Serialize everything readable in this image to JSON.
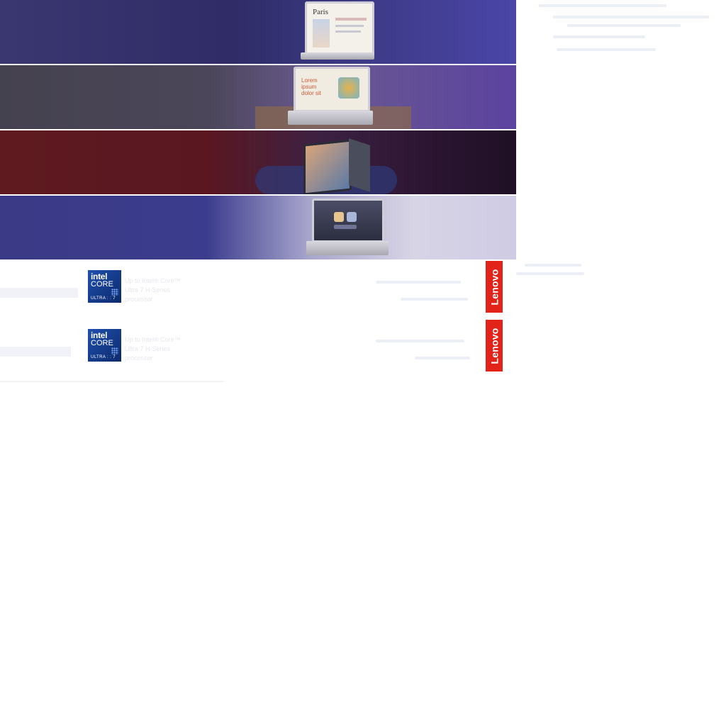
{
  "banners": [
    {
      "scene": "laptop-open-paris-page",
      "screen_text": "Paris"
    },
    {
      "scene": "laptop-open-illustration-page",
      "screen_text": "Lorem ipsum dolor sit"
    },
    {
      "scene": "convertible-tent-mode-photo"
    },
    {
      "scene": "laptop-open-app-launcher"
    }
  ],
  "footer_banners": [
    {
      "intel_word": "intel",
      "core_word": "CORE",
      "ultra_word": "ULTRA",
      "ultra_number": "7",
      "processor_line1": "Up to Intel® Core™",
      "processor_line2": "Ultra 7 H-Series",
      "processor_line3": "processor",
      "brand": "Lenovo"
    },
    {
      "intel_word": "intel",
      "core_word": "CORE",
      "ultra_word": "ULTRA",
      "ultra_number": "7",
      "processor_line1": "Up to Intel® Core™",
      "processor_line2": "Ultra 7 H-Series",
      "processor_line3": "processor",
      "brand": "Lenovo"
    }
  ],
  "colors": {
    "lenovo_red": "#e2231a",
    "intel_blue": "#1f4fae"
  }
}
